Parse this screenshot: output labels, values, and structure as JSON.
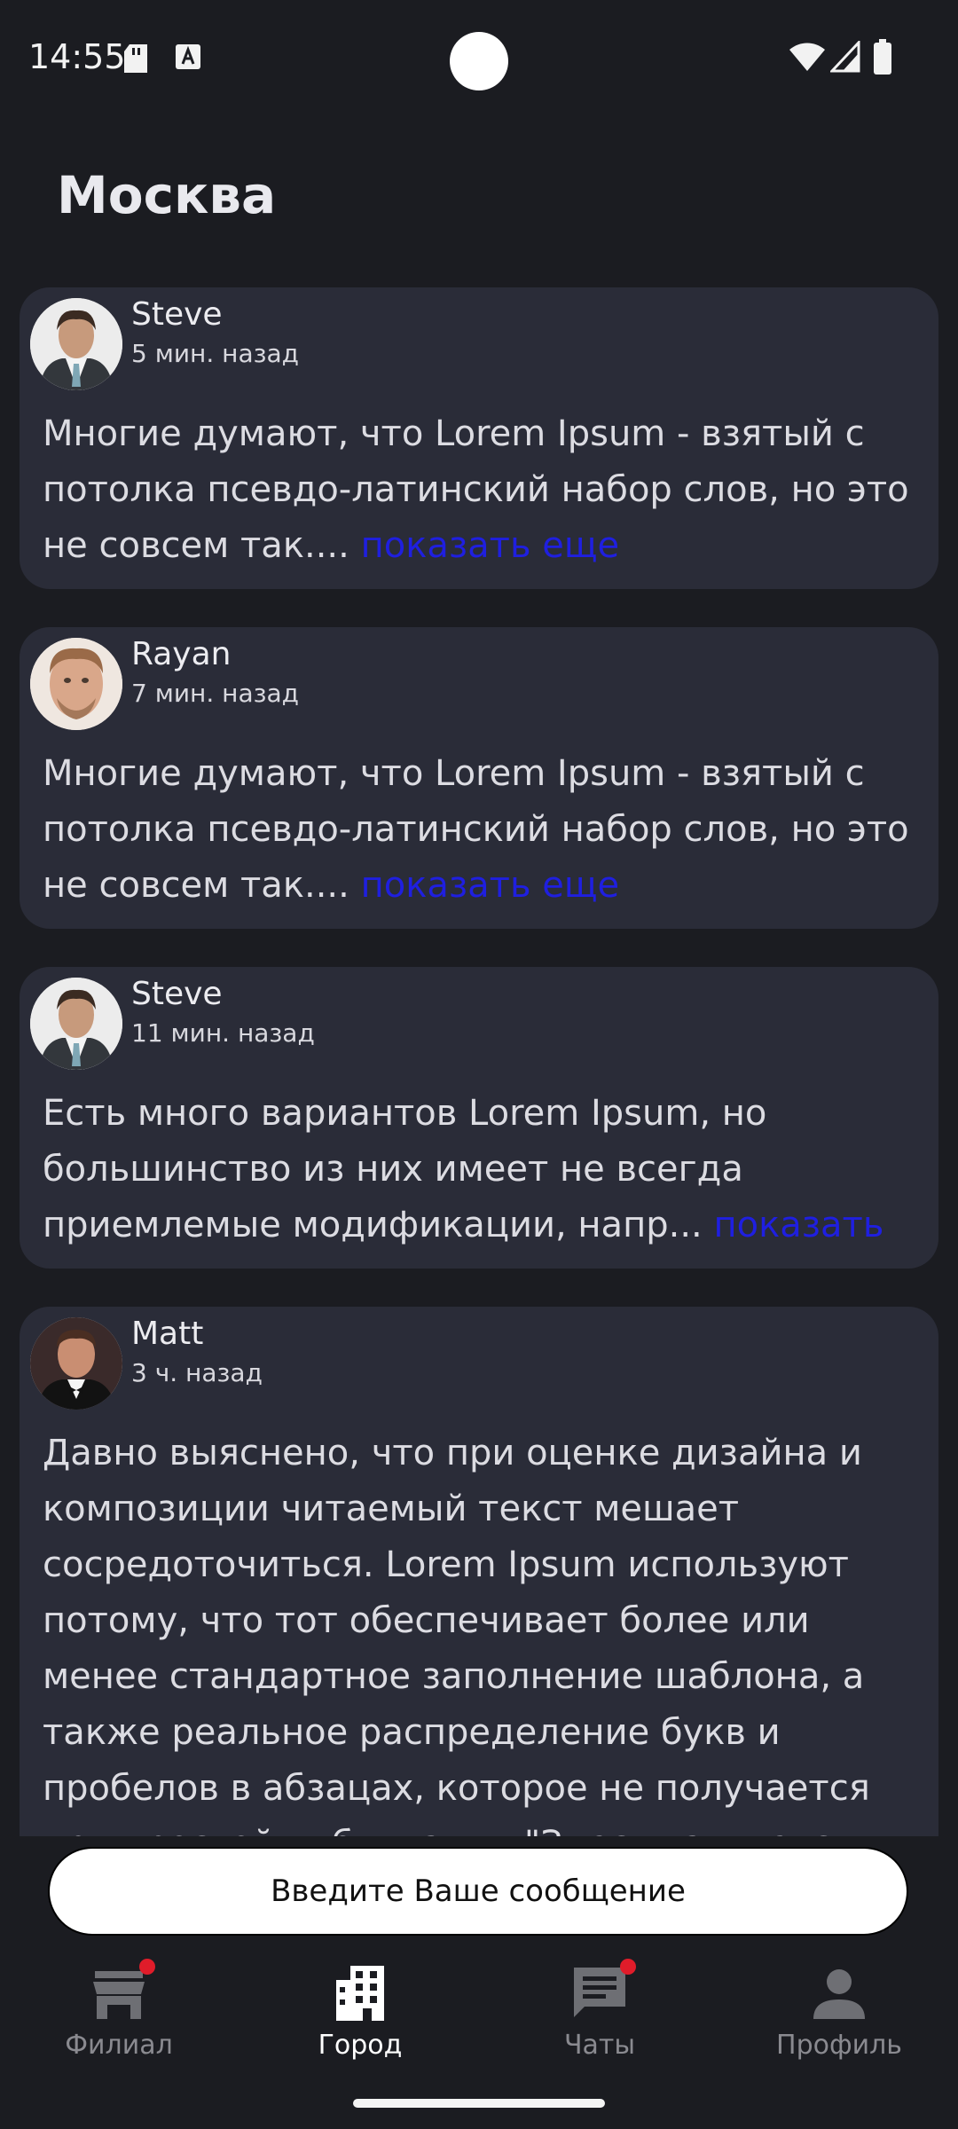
{
  "status_bar": {
    "time": "14:55"
  },
  "header": {
    "title": "Москва"
  },
  "posts": [
    {
      "author": "Steve",
      "time": "5 мин. назад",
      "text": "Многие думают, что Lorem Ipsum - взятый с потолка псевдо-латинский набор слов, но это не совсем так....",
      "more": "показать еще"
    },
    {
      "author": "Rayan",
      "time": "7 мин. назад",
      "text": "Многие думают, что Lorem Ipsum - взятый с потолка псевдо-латинский набор слов, но это не совсем так....",
      "more": "показать еще"
    },
    {
      "author": "Steve",
      "time": "11 мин. назад",
      "text": "Есть много вариантов Lorem Ipsum, но большинство из них имеет не всегда приемлемые модификации, напр...",
      "more": "показать е..."
    },
    {
      "author": "Matt",
      "time": "3 ч. назад",
      "text": "Давно выяснено, что при оценке дизайна и композиции читаемый текст мешает сосредоточиться. Lorem Ipsum используют потому, что тот обеспечивает более или менее стандартное заполнение шаблона, а также реальное распределение букв и пробелов в абзацах, которое не получается при простой дубликации \"Здесь ваш текст.. Здесь ваш",
      "more": ""
    }
  ],
  "compose": {
    "placeholder": "Введите Ваше сообщение"
  },
  "nav": [
    {
      "label": "Филиал",
      "icon": "store-icon",
      "active": false,
      "badge": true
    },
    {
      "label": "Город",
      "icon": "city-icon",
      "active": true,
      "badge": false
    },
    {
      "label": "Чаты",
      "icon": "chat-icon",
      "active": false,
      "badge": true
    },
    {
      "label": "Профиль",
      "icon": "person-icon",
      "active": false,
      "badge": false
    }
  ],
  "colors": {
    "background": "#1b1c21",
    "card": "#2a2c38",
    "link": "#1f1fe0",
    "badge": "#e01c2a",
    "nav_active": "#ffffff",
    "nav_inactive": "#8a8a90"
  }
}
